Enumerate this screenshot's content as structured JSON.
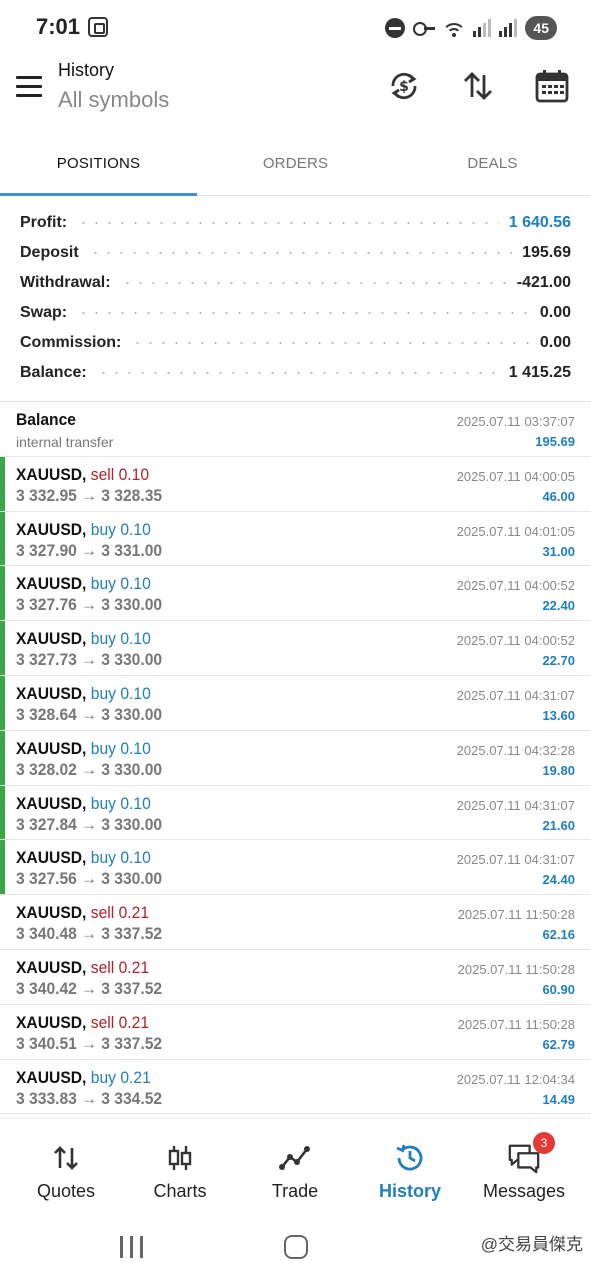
{
  "status_bar": {
    "time": "7:01",
    "battery": "45"
  },
  "app_bar": {
    "title": "History",
    "subtitle": "All symbols",
    "icons": [
      "sync-icon",
      "sort-icon",
      "calendar-icon"
    ]
  },
  "tabs": [
    {
      "label": "POSITIONS",
      "active": true
    },
    {
      "label": "ORDERS",
      "active": false
    },
    {
      "label": "DEALS",
      "active": false
    }
  ],
  "summary": [
    {
      "label": "Profit:",
      "value": "1 640.56",
      "highlight": true
    },
    {
      "label": "Deposit",
      "value": "195.69",
      "highlight": false
    },
    {
      "label": "Withdrawal:",
      "value": "-421.00",
      "highlight": false
    },
    {
      "label": "Swap:",
      "value": "0.00",
      "highlight": false
    },
    {
      "label": "Commission:",
      "value": "0.00",
      "highlight": false
    },
    {
      "label": "Balance:",
      "value": "1 415.25",
      "highlight": false
    }
  ],
  "rows": [
    {
      "kind": "balance",
      "symbol": "Balance",
      "sub": "internal transfer",
      "time": "2025.07.11 03:37:07",
      "pl": "195.69"
    },
    {
      "kind": "trade",
      "symbol": "XAUUSD,",
      "side": "sell",
      "volume": "0.10",
      "open": "3 332.95",
      "close": "3 328.35",
      "time": "2025.07.11 04:00:05",
      "pl": "46.00",
      "marker": true
    },
    {
      "kind": "trade",
      "symbol": "XAUUSD,",
      "side": "buy",
      "volume": "0.10",
      "open": "3 327.90",
      "close": "3 331.00",
      "time": "2025.07.11 04:01:05",
      "pl": "31.00",
      "marker": true
    },
    {
      "kind": "trade",
      "symbol": "XAUUSD,",
      "side": "buy",
      "volume": "0.10",
      "open": "3 327.76",
      "close": "3 330.00",
      "time": "2025.07.11 04:00:52",
      "pl": "22.40",
      "marker": true
    },
    {
      "kind": "trade",
      "symbol": "XAUUSD,",
      "side": "buy",
      "volume": "0.10",
      "open": "3 327.73",
      "close": "3 330.00",
      "time": "2025.07.11 04:00:52",
      "pl": "22.70",
      "marker": true
    },
    {
      "kind": "trade",
      "symbol": "XAUUSD,",
      "side": "buy",
      "volume": "0.10",
      "open": "3 328.64",
      "close": "3 330.00",
      "time": "2025.07.11 04:31:07",
      "pl": "13.60",
      "marker": true
    },
    {
      "kind": "trade",
      "symbol": "XAUUSD,",
      "side": "buy",
      "volume": "0.10",
      "open": "3 328.02",
      "close": "3 330.00",
      "time": "2025.07.11 04:32:28",
      "pl": "19.80",
      "marker": true
    },
    {
      "kind": "trade",
      "symbol": "XAUUSD,",
      "side": "buy",
      "volume": "0.10",
      "open": "3 327.84",
      "close": "3 330.00",
      "time": "2025.07.11 04:31:07",
      "pl": "21.60",
      "marker": true
    },
    {
      "kind": "trade",
      "symbol": "XAUUSD,",
      "side": "buy",
      "volume": "0.10",
      "open": "3 327.56",
      "close": "3 330.00",
      "time": "2025.07.11 04:31:07",
      "pl": "24.40",
      "marker": true
    },
    {
      "kind": "trade",
      "symbol": "XAUUSD,",
      "side": "sell",
      "volume": "0.21",
      "open": "3 340.48",
      "close": "3 337.52",
      "time": "2025.07.11 11:50:28",
      "pl": "62.16",
      "marker": false
    },
    {
      "kind": "trade",
      "symbol": "XAUUSD,",
      "side": "sell",
      "volume": "0.21",
      "open": "3 340.42",
      "close": "3 337.52",
      "time": "2025.07.11 11:50:28",
      "pl": "60.90",
      "marker": false
    },
    {
      "kind": "trade",
      "symbol": "XAUUSD,",
      "side": "sell",
      "volume": "0.21",
      "open": "3 340.51",
      "close": "3 337.52",
      "time": "2025.07.11 11:50:28",
      "pl": "62.79",
      "marker": false
    },
    {
      "kind": "trade",
      "symbol": "XAUUSD,",
      "side": "buy",
      "volume": "0.21",
      "open": "3 333.83",
      "close": "3 334.52",
      "time": "2025.07.11 12:04:34",
      "pl": "14.49",
      "marker": false
    }
  ],
  "arrow_glyph": "→",
  "bottom_nav": [
    {
      "label": "Quotes",
      "icon": "quotes-icon",
      "active": false
    },
    {
      "label": "Charts",
      "icon": "charts-icon",
      "active": false
    },
    {
      "label": "Trade",
      "icon": "trade-icon",
      "active": false
    },
    {
      "label": "History",
      "icon": "history-icon",
      "active": true
    },
    {
      "label": "Messages",
      "icon": "messages-icon",
      "active": false,
      "badge": "3"
    }
  ],
  "watermark": "@交易員傑克",
  "colors": {
    "accent": "#1e7fbf",
    "sell": "#b3202a",
    "marker": "#3aa845",
    "tab_indicator": "#3d8fd6"
  }
}
